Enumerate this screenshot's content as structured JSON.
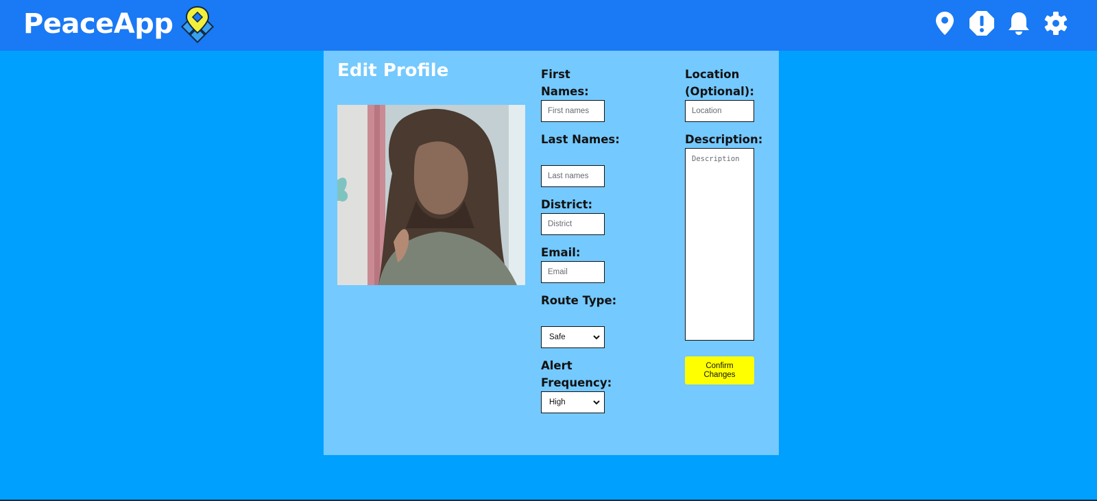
{
  "app": {
    "name": "PeaceApp",
    "brand_color": "#1a79f4",
    "background_color": "#00a0ff",
    "card_color": "#74c9fe",
    "accent_color": "#ffff00"
  },
  "nav": {
    "icons": [
      "location-pin-icon",
      "alert-icon",
      "bell-icon",
      "gear-icon"
    ]
  },
  "page": {
    "title": "Edit Profile"
  },
  "form": {
    "first_names": {
      "label": "First Names:",
      "placeholder": "First names",
      "value": ""
    },
    "last_names": {
      "label": "Last Names:",
      "placeholder": "Last names",
      "value": ""
    },
    "district": {
      "label": "District:",
      "placeholder": "District",
      "value": ""
    },
    "email": {
      "label": "Email:",
      "placeholder": "Email",
      "value": ""
    },
    "route_type": {
      "label": "Route Type:",
      "selected": "Safe"
    },
    "alert_frequency": {
      "label": "Alert Frequency:",
      "selected": "High"
    },
    "location": {
      "label": "Location (Optional):",
      "placeholder": "Location",
      "value": ""
    },
    "description": {
      "label": "Description:",
      "placeholder": "Description",
      "value": ""
    },
    "confirm_label": "Confirm Changes"
  }
}
